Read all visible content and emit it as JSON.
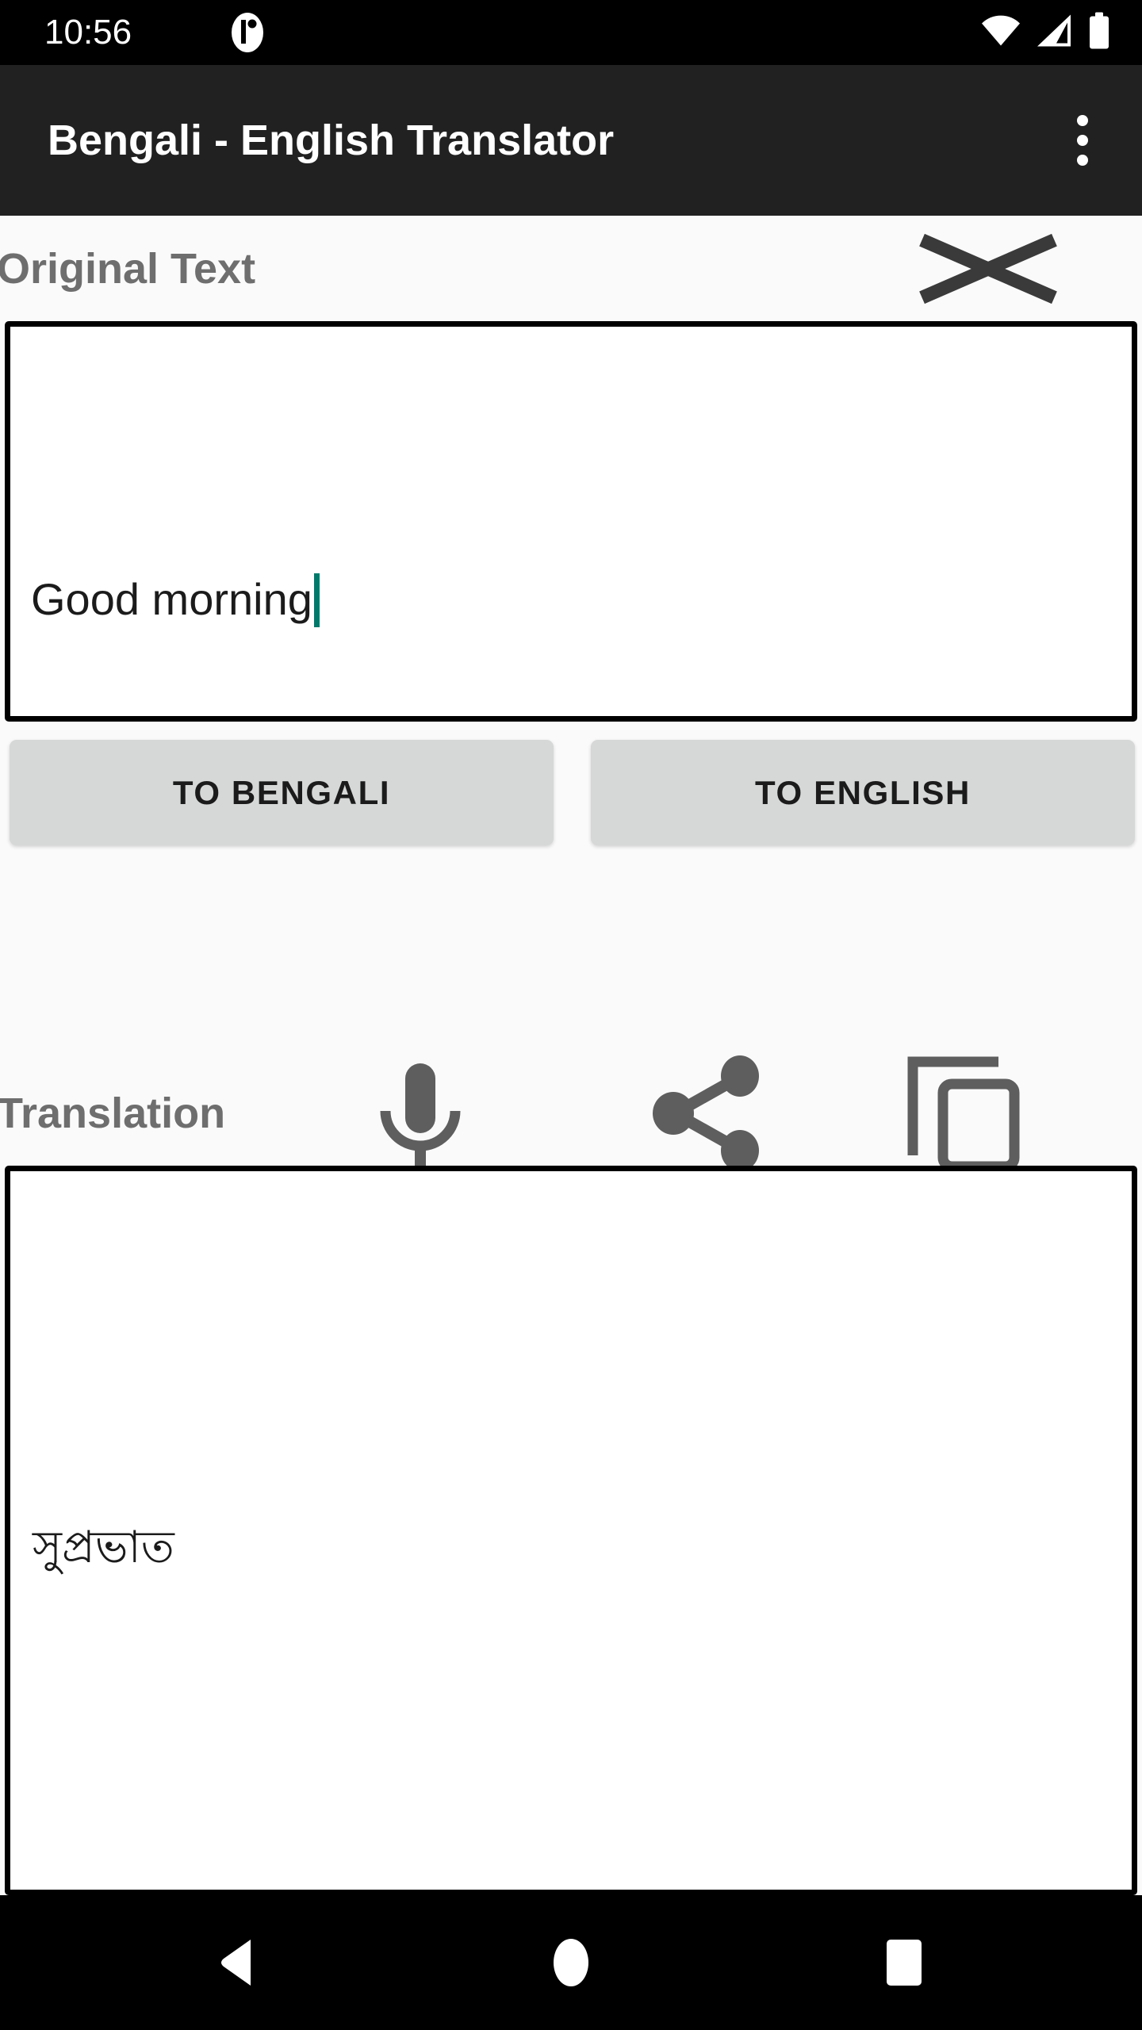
{
  "status_bar": {
    "time": "10:56",
    "notification_icon": "app-notification-icon",
    "wifi_icon": "wifi-icon",
    "signal_icon": "cellular-signal-icon",
    "battery_icon": "battery-full-icon",
    "background_color": "#000000"
  },
  "app_bar": {
    "title": "Bengali - English Translator",
    "overflow_icon": "overflow-menu-icon",
    "background_color": "#212121",
    "text_color": "#ffffff"
  },
  "original_section": {
    "label": "Original Text",
    "clear_icon": "clear-icon",
    "input_value": "Good morning",
    "input_placeholder": "",
    "caret_color": "#00796b",
    "label_color": "#6e6e6e"
  },
  "actions": {
    "to_bengali_label": "TO BENGALI",
    "to_english_label": "TO ENGLISH",
    "button_color": "#d6d7d7"
  },
  "translation_section": {
    "label": "Translation",
    "speak_icon": "microphone-icon",
    "share_icon": "share-icon",
    "copy_icon": "copy-icon",
    "output_value": "সুপ্রভাত",
    "label_color": "#6e6e6e",
    "icon_color": "#5e5e5e"
  },
  "nav_bar": {
    "back_icon": "back-triangle-icon",
    "home_icon": "home-circle-icon",
    "recents_icon": "recents-square-icon",
    "background_color": "#000000"
  },
  "theme": {
    "page_background": "#fafafa",
    "accent": "#00796b",
    "border": "#000000"
  }
}
